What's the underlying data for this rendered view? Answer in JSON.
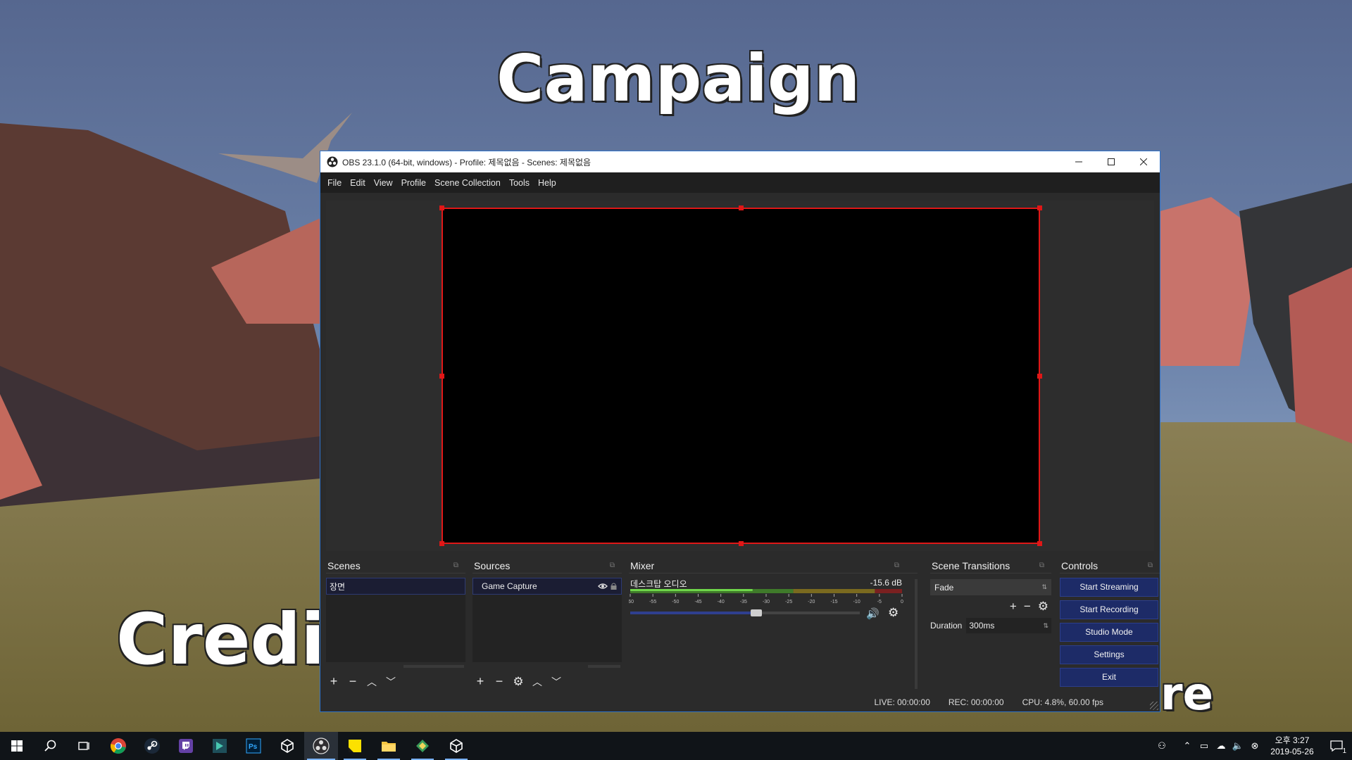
{
  "background": {
    "word_top": "Campaign",
    "word_left": "Credi",
    "word_right": "re"
  },
  "window": {
    "title": "OBS 23.1.0 (64-bit, windows) - Profile: 제목없음 - Scenes: 제목없음",
    "menu": [
      "File",
      "Edit",
      "View",
      "Profile",
      "Scene Collection",
      "Tools",
      "Help"
    ]
  },
  "scenes": {
    "title": "Scenes",
    "items": [
      "장면"
    ]
  },
  "sources": {
    "title": "Sources",
    "items": [
      "Game Capture"
    ]
  },
  "mixer": {
    "title": "Mixer",
    "track_name": "데스크탑 오디오",
    "level": "-15.6 dB",
    "scale": [
      "-60",
      "-55",
      "-50",
      "-45",
      "-40",
      "-35",
      "-30",
      "-25",
      "-20",
      "-15",
      "-10",
      "-5",
      "0"
    ],
    "volume_fraction": 0.55
  },
  "transitions": {
    "title": "Scene Transitions",
    "selected": "Fade",
    "duration_label": "Duration",
    "duration_value": "300ms"
  },
  "controls": {
    "title": "Controls",
    "buttons": [
      "Start Streaming",
      "Start Recording",
      "Studio Mode",
      "Settings",
      "Exit"
    ]
  },
  "status": {
    "live": "LIVE: 00:00:00",
    "rec": "REC: 00:00:00",
    "cpu": "CPU: 4.8%, 60.00 fps"
  },
  "taskbar": {
    "apps": [
      "windows-start-icon",
      "search-icon",
      "task-view-icon",
      "chrome-icon",
      "steam-icon",
      "twitch-icon",
      "game-app-icon",
      "photoshop-icon",
      "unity-icon",
      "obs-icon",
      "sticky-notes-icon",
      "file-explorer-icon",
      "map-app-icon",
      "unity-icon"
    ],
    "clock_time": "오후 3:27",
    "clock_date": "2019-05-26",
    "notification_count": "1"
  },
  "colors": {
    "accent": "#1d2b67",
    "selection_border": "#e01717",
    "window_border": "#2f73c9"
  }
}
